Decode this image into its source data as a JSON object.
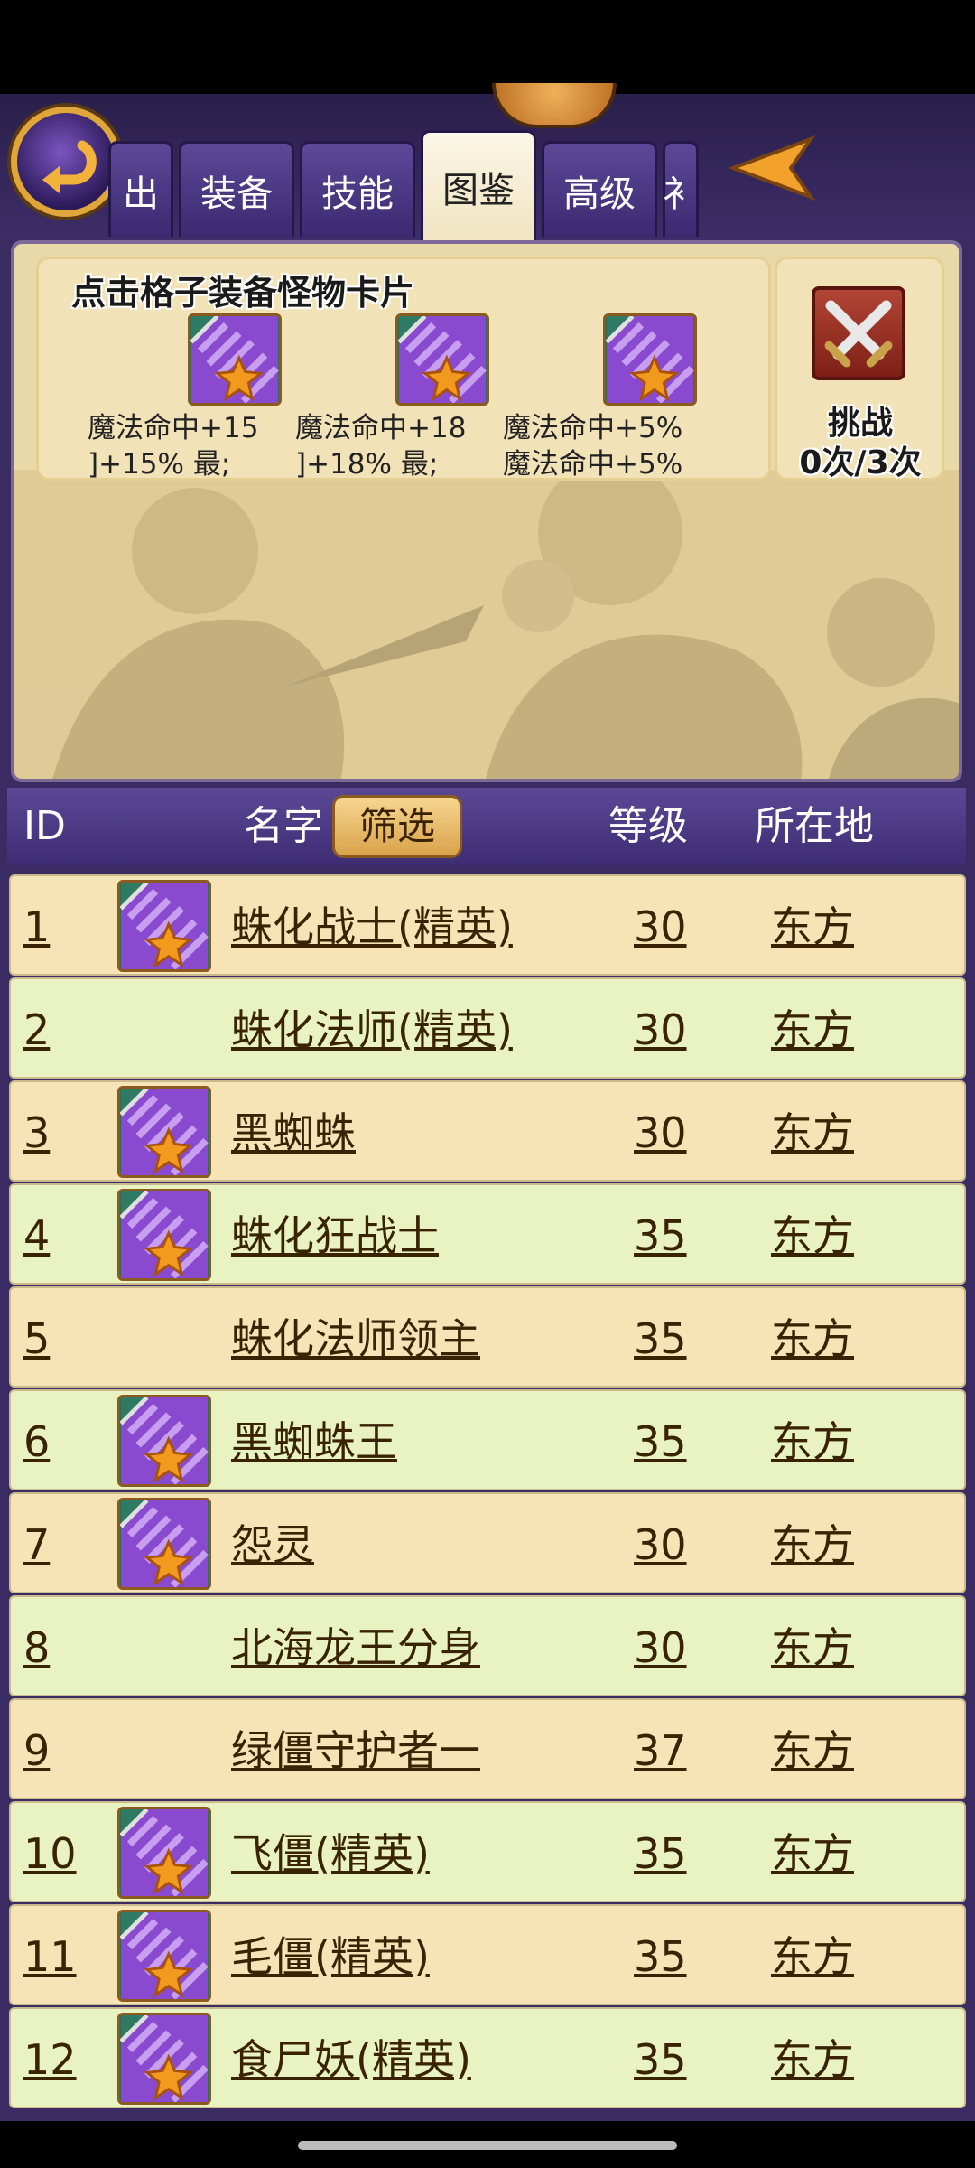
{
  "tabs": [
    {
      "label": "出",
      "active": false
    },
    {
      "label": "装备",
      "active": false
    },
    {
      "label": "技能",
      "active": false
    },
    {
      "label": "图鉴",
      "active": true
    },
    {
      "label": "高级",
      "active": false
    },
    {
      "label": "衤",
      "active": false
    }
  ],
  "card_panel": {
    "hint": "点击格子装备怪物卡片",
    "slots": [
      {
        "line1": "魔法命中+15",
        "line2": "]+15%     最;"
      },
      {
        "line1": "魔法命中+18",
        "line2": "]+18%     最;"
      },
      {
        "line1": "魔法命中+5%",
        "line2": "魔法命中+5%"
      }
    ],
    "challenge": {
      "label": "挑战",
      "count": "0次/3次"
    }
  },
  "table": {
    "headers": {
      "id": "ID",
      "name": "名字",
      "filter": "筛选",
      "level": "等级",
      "location": "所在地"
    },
    "rows": [
      {
        "id": "1",
        "name": "蛛化战士(精英)",
        "level": "30",
        "location": "东方",
        "has_card": true
      },
      {
        "id": "2",
        "name": "蛛化法师(精英)",
        "level": "30",
        "location": "东方",
        "has_card": false
      },
      {
        "id": "3",
        "name": "黑蜘蛛",
        "level": "30",
        "location": "东方",
        "has_card": true
      },
      {
        "id": "4",
        "name": "蛛化狂战士",
        "level": "35",
        "location": "东方",
        "has_card": true
      },
      {
        "id": "5",
        "name": "蛛化法师领主",
        "level": "35",
        "location": "东方",
        "has_card": false
      },
      {
        "id": "6",
        "name": "黑蜘蛛王",
        "level": "35",
        "location": "东方",
        "has_card": true
      },
      {
        "id": "7",
        "name": "怨灵",
        "level": "30",
        "location": "东方",
        "has_card": true
      },
      {
        "id": "8",
        "name": "北海龙王分身",
        "level": "30",
        "location": "东方",
        "has_card": false
      },
      {
        "id": "9",
        "name": "绿僵守护者一",
        "level": "37",
        "location": "东方",
        "has_card": false
      },
      {
        "id": "10",
        "name": "飞僵(精英)",
        "level": "35",
        "location": "东方",
        "has_card": true
      },
      {
        "id": "11",
        "name": "毛僵(精英)",
        "level": "35",
        "location": "东方",
        "has_card": true
      },
      {
        "id": "12",
        "name": "食尸妖(精英)",
        "level": "35",
        "location": "东方",
        "has_card": true
      }
    ]
  },
  "colors": {
    "frame": "#3b2b63",
    "row_odd": "#f6e3b6",
    "row_even": "#e8f3c1",
    "card_purple": "#8a4ad0",
    "card_star": "#f29a1e"
  },
  "icons": {
    "back": "back-arrow-icon",
    "next": "arrow-left-icon",
    "card": "monster-card-icon",
    "challenge": "crossed-swords-icon"
  }
}
